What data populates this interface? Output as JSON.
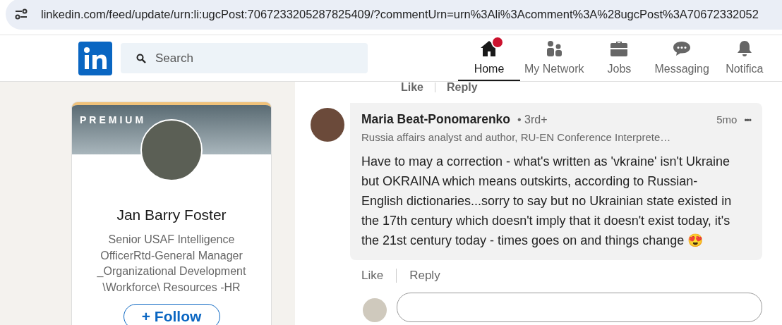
{
  "browser": {
    "url": "linkedin.com/feed/update/urn:li:ugcPost:7067233205287825409/?commentUrn=urn%3Ali%3Acomment%3A%28ugcPost%3A70672332052"
  },
  "nav": {
    "search": {
      "placeholder": "Search"
    },
    "items": [
      {
        "label": "Home",
        "selected": true,
        "badge": true
      },
      {
        "label": "My Network",
        "selected": false,
        "badge": false
      },
      {
        "label": "Jobs",
        "selected": false,
        "badge": false
      },
      {
        "label": "Messaging",
        "selected": false,
        "badge": false
      },
      {
        "label": "Notifica",
        "selected": false,
        "badge": false
      }
    ]
  },
  "profile_card": {
    "banner_label": "PREMIUM",
    "name": "Jan Barry Foster",
    "headline": "Senior USAF Intelligence OfficerRtd-General Manager _Organizational Development \\Workforce\\ Resources -HR",
    "follow_button": "+ Follow"
  },
  "previous_actions": [
    "Like",
    "Reply"
  ],
  "comment": {
    "author": "Maria Beat-Ponomarenko",
    "degree": "• 3rd+",
    "headline": "Russia affairs analyst and author, RU-EN Conference Interprete…",
    "time": "5mo",
    "more": "•••",
    "text": "Have to may a correction - what's written as 'vkraine' isn't Ukraine but OKRAINA which means outskirts, according to Russian-English dictionaries...sorry to say but no Ukrainian state existed in the 17th century which doesn't imply that it doesn't exist today, it's the 21st century today - times goes on and things change 😍",
    "actions": [
      "Like",
      "Reply"
    ]
  }
}
